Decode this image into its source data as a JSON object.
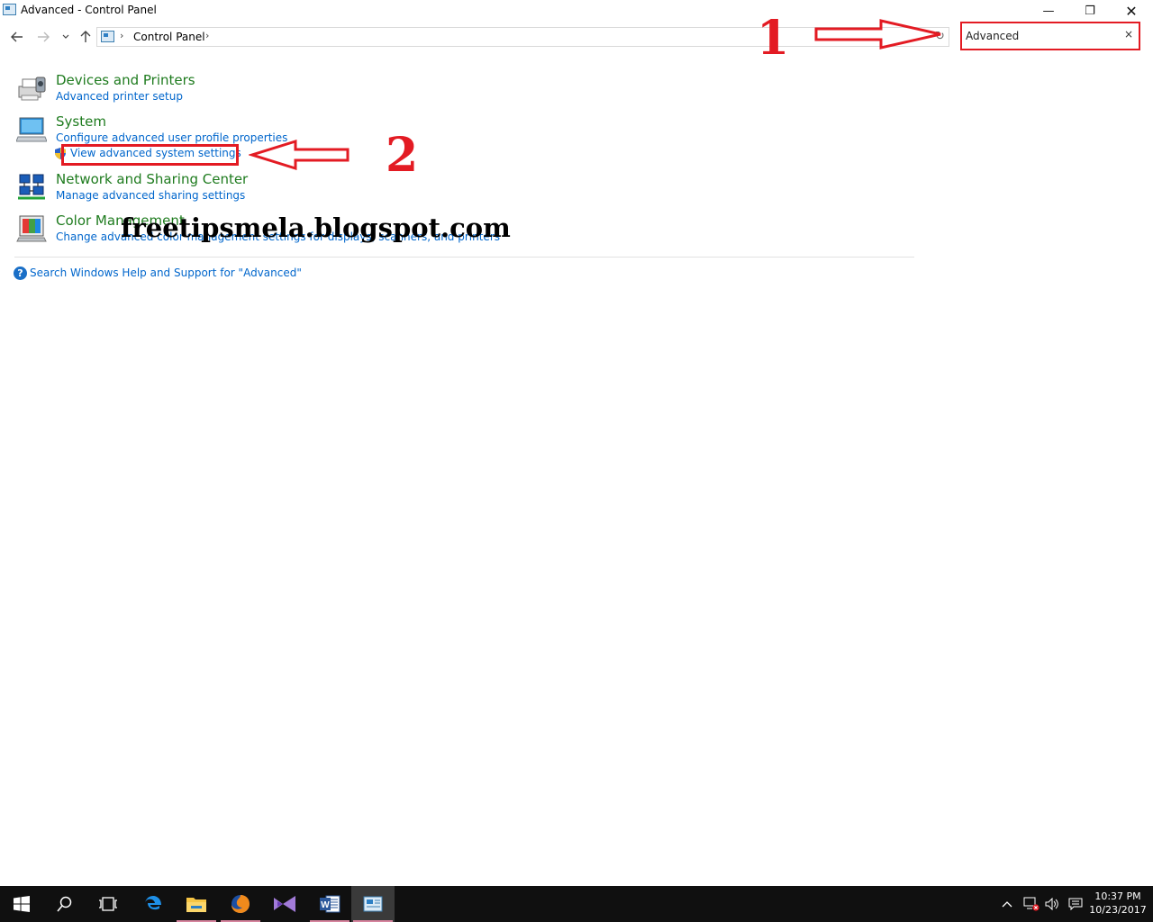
{
  "window": {
    "title": "Advanced - Control Panel",
    "controls": {
      "minimize": "—",
      "maximize": "❐",
      "close": "✕"
    }
  },
  "address_bar": {
    "breadcrumb": "Control Panel",
    "chevron": "›"
  },
  "search": {
    "value": "Advanced",
    "clear_symbol": "×"
  },
  "results": [
    {
      "title": "Devices and Printers",
      "icon": "printer-icon",
      "links": [
        "Advanced printer setup"
      ]
    },
    {
      "title": "System",
      "icon": "computer-icon",
      "links": [
        "Configure advanced user profile properties",
        "View advanced system settings"
      ]
    },
    {
      "title": "Network and Sharing Center",
      "icon": "network-icon",
      "links": [
        "Manage advanced sharing settings"
      ]
    },
    {
      "title": "Color Management",
      "icon": "color-management-icon",
      "links": [
        "Change advanced color management settings for displays, scanners, and printers"
      ]
    }
  ],
  "help": {
    "text": "Search Windows Help and Support for \"Advanced\""
  },
  "annotations": {
    "step1": "1",
    "step2": "2",
    "watermark": "freetipsmela.blogspot.com",
    "color": "#e31b23"
  },
  "taskbar": {
    "apps": [
      "start-icon",
      "search-icon",
      "task-view-icon",
      "edge-icon",
      "file-explorer-icon",
      "firefox-icon",
      "visual-studio-icon",
      "word-icon",
      "control-panel-icon"
    ],
    "time": "10:37 PM",
    "date": "10/23/2017"
  },
  "colors": {
    "group_title": "#1e7b1e",
    "link": "#0066cc",
    "taskbar": "#101010"
  }
}
